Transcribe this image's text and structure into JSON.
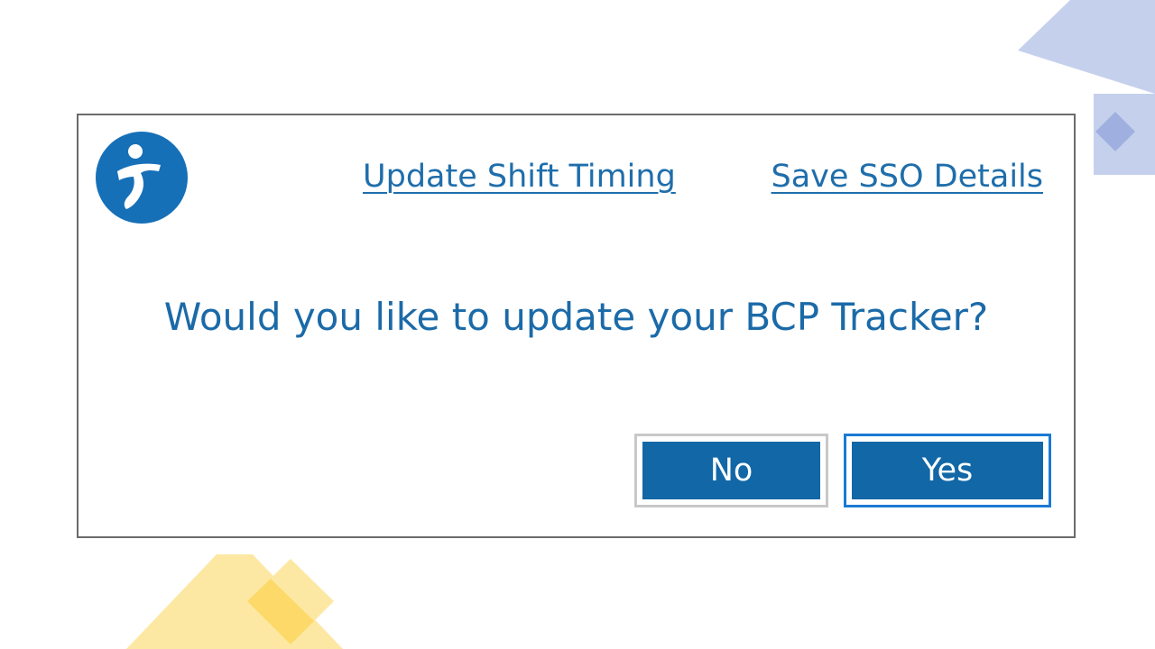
{
  "dialog": {
    "links": {
      "update_shift_timing": "Update Shift Timing",
      "save_sso_details": "Save SSO Details"
    },
    "question": "Would you like to update your BCP Tracker?",
    "buttons": {
      "no": "No",
      "yes": "Yes"
    }
  },
  "colors": {
    "accent_blue": "#1267a6",
    "text_blue": "#1b6aa8",
    "decor_blue": "#c5d1ec",
    "decor_yellow": "#fde8a3"
  },
  "icons": {
    "logo": "runner-logo-icon"
  }
}
